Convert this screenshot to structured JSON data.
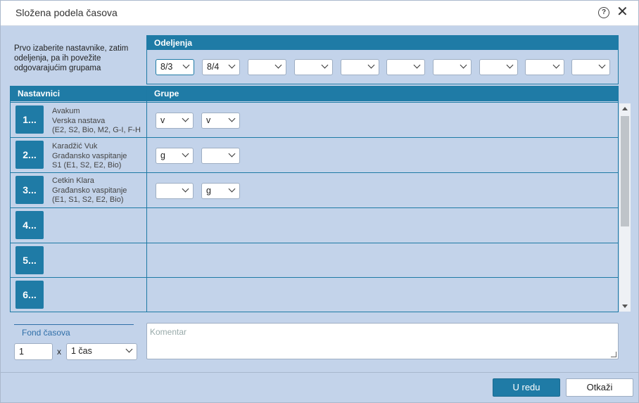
{
  "dialog": {
    "title": "Složena podela časova",
    "help_icon": "?",
    "close_icon": "✕"
  },
  "instructions": "Prvo izaberite nastavnike, zatim odeljenja, pa ih povežite odgovarajućim grupama",
  "odeljenja": {
    "header": "Odeljenja",
    "selects": [
      "8/3",
      "8/4",
      "",
      "",
      "",
      "",
      "",
      "",
      "",
      ""
    ]
  },
  "nastavnici_header": "Nastavnici",
  "grupe_header": "Grupe",
  "rows": [
    {
      "num": "1...",
      "line1": "Avakum",
      "line2": "Verska nastava",
      "line3": "(E2, S2, Bio, M2, G-I, F-H",
      "groups": [
        "v",
        "v"
      ]
    },
    {
      "num": "2...",
      "line1": "Karadžić Vuk",
      "line2": "Građansko vaspitanje",
      "line3": "S1 (E1, S2, E2, Bio)",
      "groups": [
        "g",
        ""
      ]
    },
    {
      "num": "3...",
      "line1": "Cetkin Klara",
      "line2": "Građansko vaspitanje",
      "line3": "(E1, S1, S2, E2, Bio)",
      "groups": [
        "",
        "g"
      ]
    },
    {
      "num": "4..."
    },
    {
      "num": "5..."
    },
    {
      "num": "6..."
    }
  ],
  "fond": {
    "label": "Fond časova",
    "value": "1",
    "times": "x",
    "unit": "1 čas"
  },
  "comment_placeholder": "Komentar",
  "buttons": {
    "ok": "U redu",
    "cancel": "Otkaži"
  }
}
